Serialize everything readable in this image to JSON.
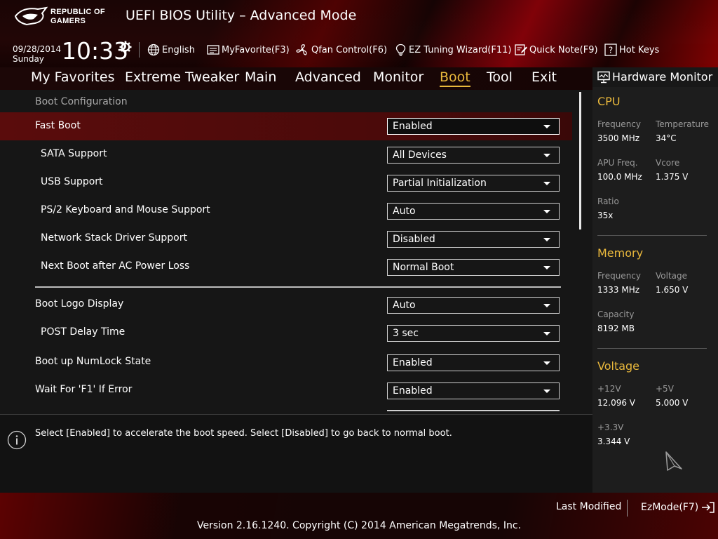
{
  "app": {
    "brand_line1": "REPUBLIC OF",
    "brand_line2": "GAMERS",
    "title": "UEFI BIOS Utility – Advanced Mode"
  },
  "clock": {
    "date": "09/28/2014",
    "day": "Sunday",
    "time": "10:33"
  },
  "toolbar": {
    "language": "English",
    "my_favorite": "MyFavorite(F3)",
    "qfan": "Qfan Control(F6)",
    "ez_tuning": "EZ Tuning Wizard(F11)",
    "quick_note": "Quick Note(F9)",
    "hot_keys": "Hot Keys"
  },
  "tabs": [
    {
      "label": "My Favorites"
    },
    {
      "label": "Extreme Tweaker"
    },
    {
      "label": "Main"
    },
    {
      "label": "Advanced"
    },
    {
      "label": "Monitor"
    },
    {
      "label": "Boot",
      "active": true
    },
    {
      "label": "Tool"
    },
    {
      "label": "Exit"
    }
  ],
  "boot": {
    "section_title": "Boot Configuration",
    "settings": [
      {
        "label": "Fast Boot",
        "value": "Enabled",
        "selected": true
      },
      {
        "label": "SATA Support",
        "value": "All Devices"
      },
      {
        "label": "USB Support",
        "value": "Partial Initialization"
      },
      {
        "label": "PS/2 Keyboard and Mouse Support",
        "value": "Auto"
      },
      {
        "label": "Network Stack Driver Support",
        "value": "Disabled"
      },
      {
        "label": "Next Boot after AC Power Loss",
        "value": "Normal Boot"
      },
      {
        "label": "Boot Logo Display",
        "value": "Auto"
      },
      {
        "label": "POST Delay Time",
        "value": "3 sec"
      },
      {
        "label": "Boot up NumLock State",
        "value": "Enabled"
      },
      {
        "label": "Wait For 'F1' If Error",
        "value": "Enabled"
      }
    ]
  },
  "help": {
    "text": "Select [Enabled] to accelerate the boot speed. Select [Disabled] to go back to normal boot."
  },
  "hw_monitor": {
    "title": "Hardware Monitor",
    "cpu": {
      "title": "CPU",
      "frequency_label": "Frequency",
      "frequency": "3500 MHz",
      "temperature_label": "Temperature",
      "temperature": "34°C",
      "apu_label": "APU Freq.",
      "apu": "100.0 MHz",
      "vcore_label": "Vcore",
      "vcore": "1.375 V",
      "ratio_label": "Ratio",
      "ratio": "35x"
    },
    "memory": {
      "title": "Memory",
      "frequency_label": "Frequency",
      "frequency": "1333 MHz",
      "voltage_label": "Voltage",
      "voltage": "1.650 V",
      "capacity_label": "Capacity",
      "capacity": "8192 MB"
    },
    "voltage": {
      "title": "Voltage",
      "v12_label": "+12V",
      "v12": "12.096 V",
      "v5_label": "+5V",
      "v5": "5.000 V",
      "v33_label": "+3.3V",
      "v33": "3.344 V"
    }
  },
  "footer": {
    "last_modified": "Last Modified",
    "ezmode": "EzMode(F7)",
    "copyright": "Version 2.16.1240. Copyright (C) 2014 American Megatrends, Inc."
  },
  "colors": {
    "accent": "#e9b83c",
    "highlight": "#5a0c0c",
    "background": "#161616"
  }
}
